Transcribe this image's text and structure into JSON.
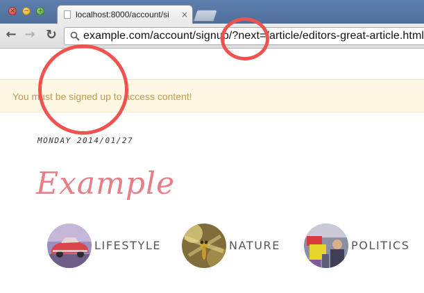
{
  "browser": {
    "tab_title": "localhost:8000/account/si",
    "tab_close": "×",
    "url": "example.com/account/signup/?next=/article/editors-great-article.html"
  },
  "page": {
    "alert": "You must be signed up to access content!",
    "date": "Monday 2014/01/27",
    "site_title": "Example",
    "categories": [
      {
        "label": "LIFESTYLE",
        "icon": "lifestyle-thumbnail"
      },
      {
        "label": "NATURE",
        "icon": "nature-thumbnail"
      },
      {
        "label": "POLITICS",
        "icon": "politics-thumbnail"
      }
    ]
  },
  "colors": {
    "alert_bg": "#fcf8e3",
    "alert_text": "#c09853",
    "title": "#e87e85",
    "annotation": "#f0524f"
  }
}
